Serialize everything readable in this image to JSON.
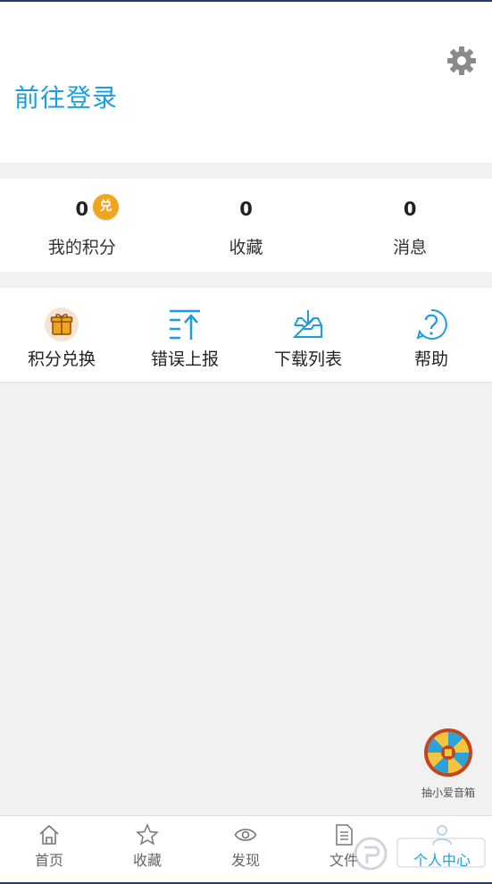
{
  "header": {
    "login_text": "前往登录"
  },
  "stats": [
    {
      "value": "0",
      "label": "我的积分"
    },
    {
      "value": "0",
      "label": "收藏"
    },
    {
      "value": "0",
      "label": "消息"
    }
  ],
  "points_badge": "兑",
  "tools": [
    {
      "label": "积分兑换",
      "icon": "gift-icon"
    },
    {
      "label": "错误上报",
      "icon": "upload-report-icon"
    },
    {
      "label": "下载列表",
      "icon": "download-tray-icon"
    },
    {
      "label": "帮助",
      "icon": "help-icon"
    }
  ],
  "lottery": {
    "label": "抽小爱音箱"
  },
  "tabbar": [
    {
      "label": "首页",
      "icon": "home-icon"
    },
    {
      "label": "收藏",
      "icon": "star-icon"
    },
    {
      "label": "发现",
      "icon": "eye-icon"
    },
    {
      "label": "文件",
      "icon": "document-icon"
    },
    {
      "label": "个人中心",
      "icon": "user-icon",
      "active": true
    }
  ],
  "colors": {
    "accent": "#1a9ee0",
    "badge": "#f0a51e",
    "background": "#f1f1f1"
  }
}
